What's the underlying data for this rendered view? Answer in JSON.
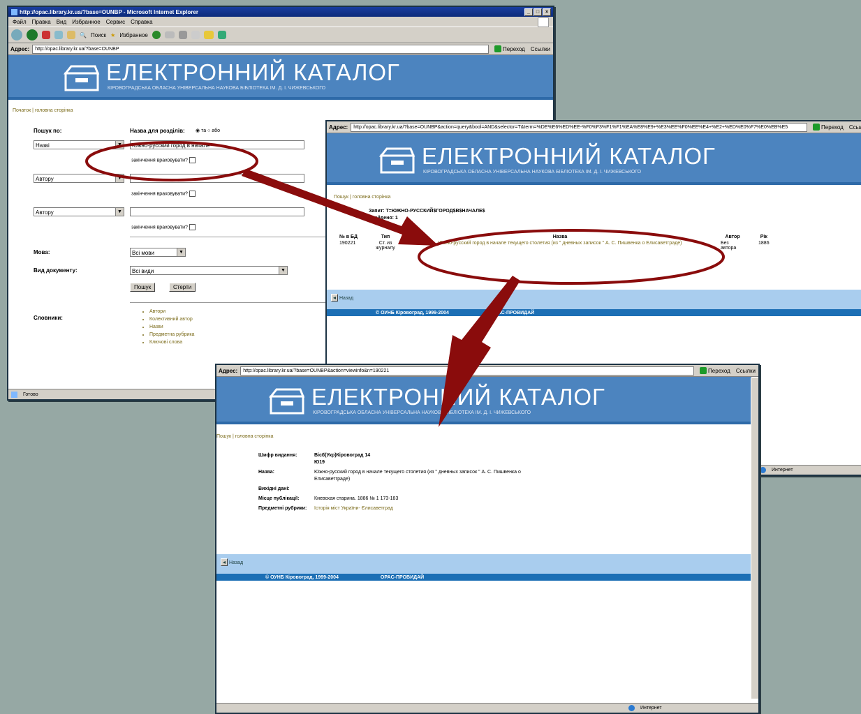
{
  "window1": {
    "title": "http://opac.library.kr.ua/?base=OUNBP - Microsoft Internet Explorer",
    "menu": [
      "Файл",
      "Правка",
      "Вид",
      "Избранное",
      "Сервис",
      "Справка"
    ],
    "toolbar": {
      "search": "Поиск",
      "favorites": "Избранное"
    },
    "address_label": "Адрес:",
    "address_value": "http://opac.library.kr.ua/?base=OUNBP",
    "go_label": "Переход",
    "links_label": "Ссылки",
    "breadcrumb": "Початок | головна сторінка",
    "search_by_label": "Пошук по:",
    "search_term_label": "Назва для розділів:",
    "radio_and": "та",
    "radio_or": "або",
    "rows": [
      {
        "field": "Назві",
        "value": "Южно-русский город в начале",
        "truncation": "закінчення враховувати?"
      },
      {
        "field": "Автору",
        "value": "",
        "truncation": "закінчення враховувати?"
      },
      {
        "field": "Автору",
        "value": "",
        "truncation": "закінчення враховувати?"
      }
    ],
    "language_label": "Мова:",
    "language_value": "Всі мови",
    "doctype_label": "Вид документу:",
    "doctype_value": "Всі види",
    "search_button": "Пошук",
    "clear_button": "Стерти",
    "index_label": "Словники:",
    "index_items": [
      "Автори",
      "Колективний автор",
      "Назви",
      "Предметна рубрика",
      "Ключові слова"
    ],
    "status": "Готово"
  },
  "window2": {
    "address_label": "Адрес:",
    "address_value": "http://opac.library.kr.ua/?base=OUNBP&action=query&bool=AND&selector=T&term=%DE%E6%ED%EE-%F0%F3%F1%F1%EA%E8%E9+%E3%EE%F0%EE%E4+%E2+%ED%E0%F7%E0%EB%E5",
    "go_label": "Переход",
    "links_label": "Ссылки",
    "breadcrumb": "Пошук | головна сторінка",
    "query_line": "Запит: T=ЮЖНО-РУССКИЙ$ГОРОД$В$НАЧАЛЕ$",
    "found_line": "Знайдено: 1",
    "table_headers": [
      "№ в БД",
      "Тип",
      "Назва",
      "Автор",
      "Рік"
    ],
    "table_row": {
      "id": "190221",
      "type": "Ст. из журналу",
      "title": "Южно-русский город в начале текущего столетия (из \" дневных записок \" А. С. Пишвенка о Елисаветграде)",
      "author": "Без автора",
      "year": "1886"
    },
    "back_label": "Назад",
    "copyright": "© ОУНБ Кіровоград, 1999-2004",
    "engine": "OPAC-ПРОВИДАЙ",
    "status": "Интернет"
  },
  "window3": {
    "address_label": "Адрес:",
    "address_value": "http://opac.library.kr.ua/?base=OUNBP&action=viewinfo&n=190221",
    "go_label": "Переход",
    "links_label": "Ссылки",
    "breadcrumb": "Пошук | головна сторінка",
    "fields": [
      {
        "label": "Шифр видання:",
        "value": "Вісб(Укр)Кіровоград 14\nЮ19"
      },
      {
        "label": "Назва:",
        "value": "Южно-русский город в начале текущего столетия (из \" дневных записок \" А. С. Пишвенка о Елисаветграде)"
      },
      {
        "label": "Вихідні дані:",
        "value": ""
      },
      {
        "label": "Місце публікації:",
        "value": "Киевская старина. 1886 № 1 173-183"
      },
      {
        "label": "Предметні рубрики:",
        "value": "Історія міст України- Єлисаветград"
      }
    ],
    "back_label": "Назад",
    "copyright": "© ОУНБ Кіровоград, 1999-2004",
    "engine": "OPAC-ПРОВИДАЙ",
    "status": "Интернет"
  },
  "banner": {
    "title": "ЕЛЕКТРОННИЙ КАТАЛОГ",
    "subtitle": "КІРОВОГРАДСЬКА ОБЛАСНА УНІВЕРСАЛЬНА НАУКОВА БІБЛІОТЕКА ІМ. Д. І. ЧИЖЕВСЬКОГО"
  },
  "colors": {
    "banner": "#4c84bf",
    "annotation": "#8a0c0c",
    "desktop": "#96a8a4"
  }
}
